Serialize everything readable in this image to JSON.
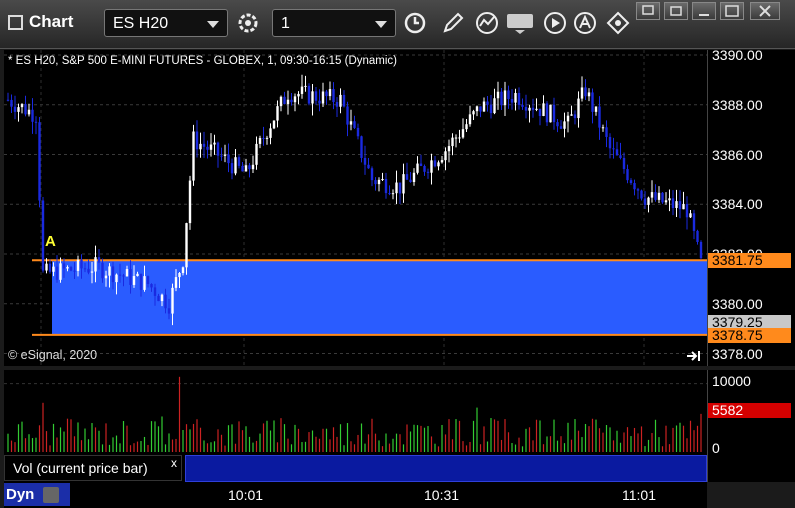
{
  "toolbar": {
    "title": "Chart",
    "symbol": "ES H20",
    "interval": "1"
  },
  "chart": {
    "description": "* ES H20, S&P 500 E-MINI FUTURES - GLOBEX, 1, 09:30-16:15 (Dynamic)",
    "copyright": "© eSignal, 2020",
    "marker_label": "A",
    "price_ticks": [
      "3390.00",
      "3388.00",
      "3386.00",
      "3384.00",
      "3382.00",
      "3380.00",
      "3378.00"
    ],
    "price_range": [
      3377.5,
      3390.2
    ],
    "tags": {
      "upper": "3381.75",
      "current": "3379.25",
      "lower": "3378.75"
    },
    "zone": {
      "top": 3381.75,
      "bottom": 3378.75
    },
    "colors": {
      "background": "#000000",
      "up_bar": "#ffffff",
      "down_bar": "#1a2ae0",
      "zone": "#2a5cff",
      "zone_line": "#ff8a1c",
      "vol_up": "#33cc33",
      "vol_down": "#cc2222"
    }
  },
  "volume": {
    "label": "Vol (current price bar)",
    "close_label": "x",
    "ticks": [
      "10000",
      "0"
    ],
    "current": "5582",
    "range": [
      0,
      12000
    ]
  },
  "time_axis": {
    "labels": [
      "10:01",
      "10:31",
      "11:01"
    ]
  },
  "status": {
    "dyn_label": "Dyn"
  }
}
